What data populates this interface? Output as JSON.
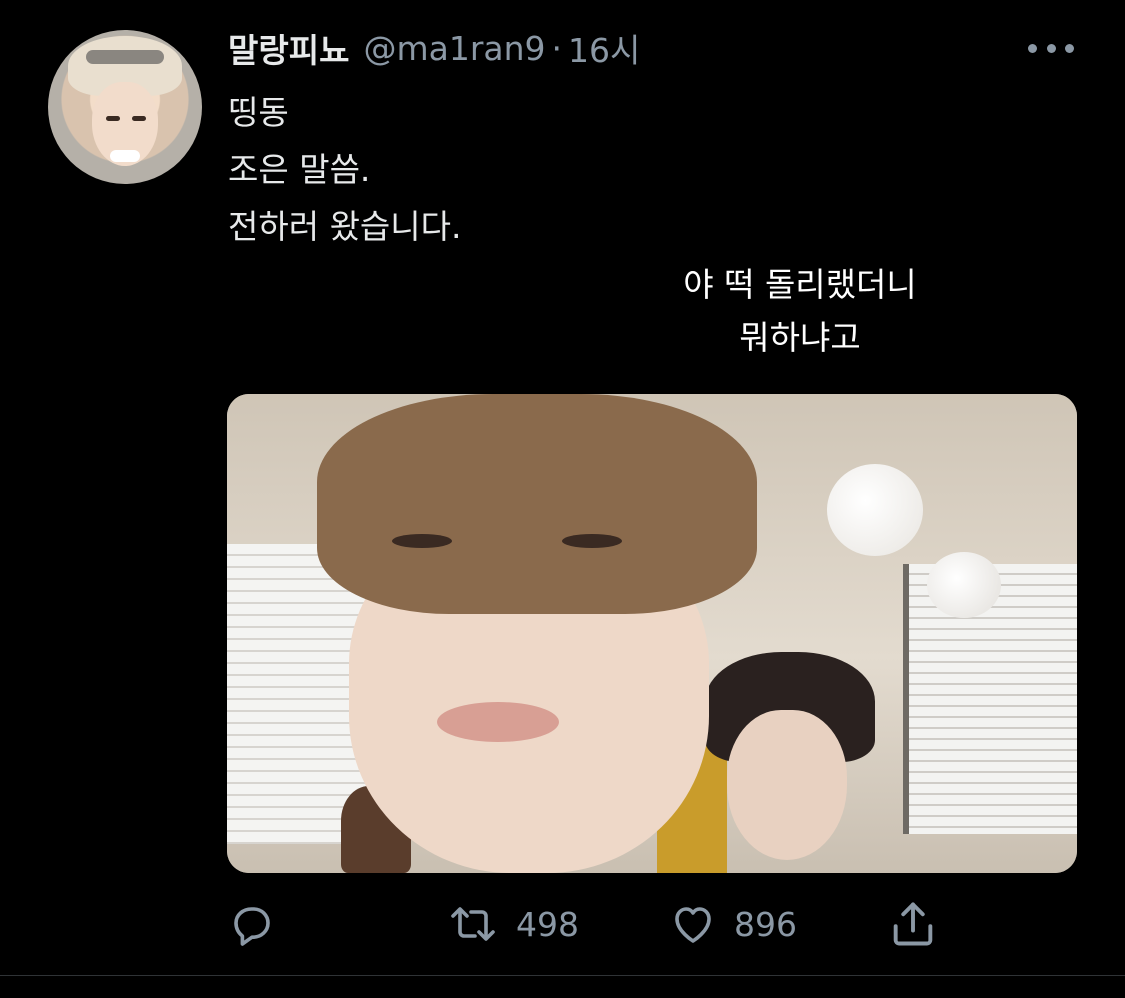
{
  "tweet": {
    "display_name": "말랑피뇨",
    "handle": "@ma1ran9",
    "separator": "·",
    "time": "16시",
    "text": "띵동\n조은 말씀.\n전하러 왔습니다.",
    "media_caption": "야 떡 돌리랬더니\n뭐하냐고"
  },
  "actions": {
    "reply_count": "",
    "retweet_count": "498",
    "like_count": "896"
  },
  "colors": {
    "background": "#000000",
    "text_primary": "#e7e9ea",
    "text_secondary": "#8b98a5",
    "divider": "#2f3336"
  },
  "icons": {
    "more": "more-horizontal-icon",
    "reply": "reply-icon",
    "retweet": "retweet-icon",
    "like": "heart-icon",
    "share": "share-icon"
  }
}
